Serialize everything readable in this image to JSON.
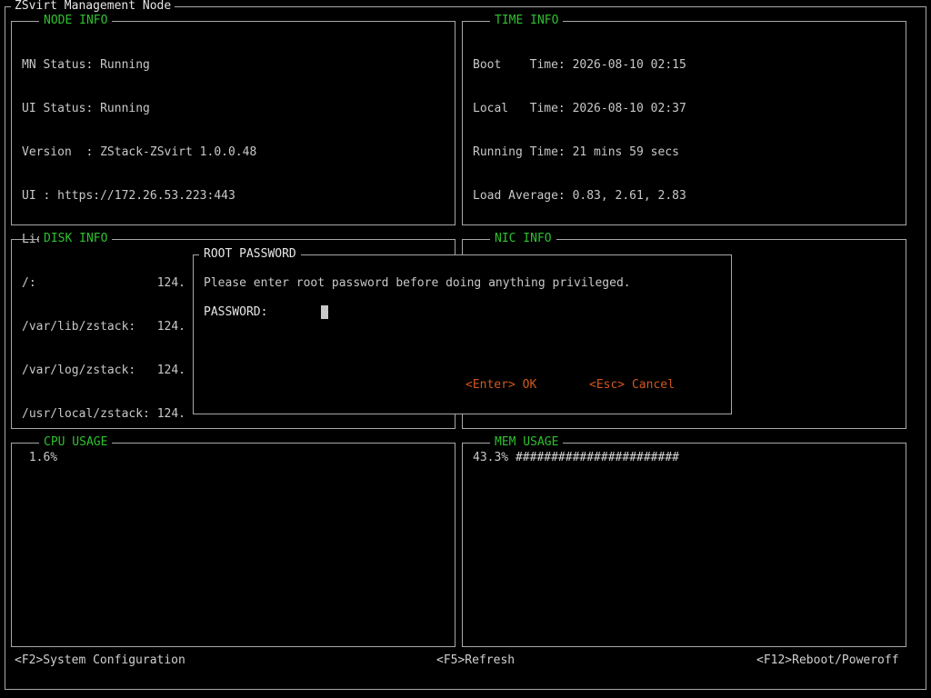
{
  "window": {
    "title": "ZSvirt Management Node"
  },
  "node_info": {
    "title": "NODE INFO",
    "lines": [
      "MN Status: Running",
      "UI Status: Running",
      "Version  : ZStack-ZSvirt 1.0.0.48",
      "UI : https://172.26.53.223:443",
      "License Type:"
    ]
  },
  "time_info": {
    "title": "TIME INFO",
    "lines": [
      "Boot    Time: 2026-08-10 02:15",
      "Local   Time: 2026-08-10 02:37",
      "Running Time: 21 mins 59 secs",
      "Load Average: 0.83, 2.61, 2.83"
    ]
  },
  "disk_info": {
    "title": "DISK INFO",
    "lines": [
      "/:                 124.",
      "/var/lib/zstack:   124.",
      "/var/log/zstack:   124.",
      "/usr/local/zstack: 124."
    ]
  },
  "nic_info": {
    "title": "NIC INFO"
  },
  "cpu_usage": {
    "title": "CPU USAGE",
    "value": " 1.6%"
  },
  "mem_usage": {
    "title": "MEM USAGE",
    "value": "43.3%",
    "bar": "#######################"
  },
  "dialog": {
    "title": "ROOT PASSWORD",
    "message": "Please enter root password before doing anything privileged.",
    "password_label": "PASSWORD:",
    "password_value": "",
    "ok_label": "<Enter> OK",
    "cancel_label": "<Esc> Cancel"
  },
  "footer": {
    "system_config": "<F2>System Configuration",
    "refresh": "<F5>Refresh",
    "reboot": "<F12>Reboot/Poweroff"
  },
  "colors": {
    "title_green": "#2ec02e",
    "button_orange": "#d0581e",
    "border": "#a8a8a8"
  }
}
